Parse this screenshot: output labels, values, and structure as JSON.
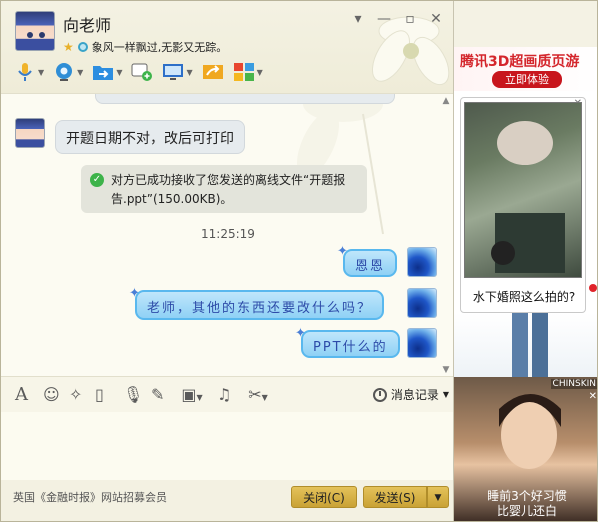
{
  "header": {
    "contact_name": "向老师",
    "status_message": "象风一样飘过,无影又无踪。"
  },
  "messages": {
    "received_1": "开题日期不对，改后可打印",
    "system_notice": "对方已成功接收了您发送的离线文件“开题报告.ppt”(150.00KB)。",
    "timestamp": "11:25:19",
    "sent_1": "恩恩",
    "sent_2": "老师，其他的东西还要改什么吗？",
    "sent_3": "PPT什么的"
  },
  "input_toolbar": {
    "history_label": "消息记录"
  },
  "footer": {
    "link_text": "英国《金融时报》网站招募会员",
    "close_label": "关闭(C)",
    "send_label": "发送(S)"
  },
  "ads": {
    "game_title": "腾讯3D超画质页游",
    "game_button": "立即体验",
    "photo_caption": "水下婚照这么拍的?",
    "video_caption_1": "睡前3个好习惯",
    "video_caption_2": "比婴儿还白",
    "video_brand": "CHINSKIN"
  },
  "colors": {
    "bubble_sent": "#8fd1f5",
    "bubble_received": "#e6ebee",
    "button_gold": "#d6b144",
    "ad_red": "#c8161d"
  }
}
